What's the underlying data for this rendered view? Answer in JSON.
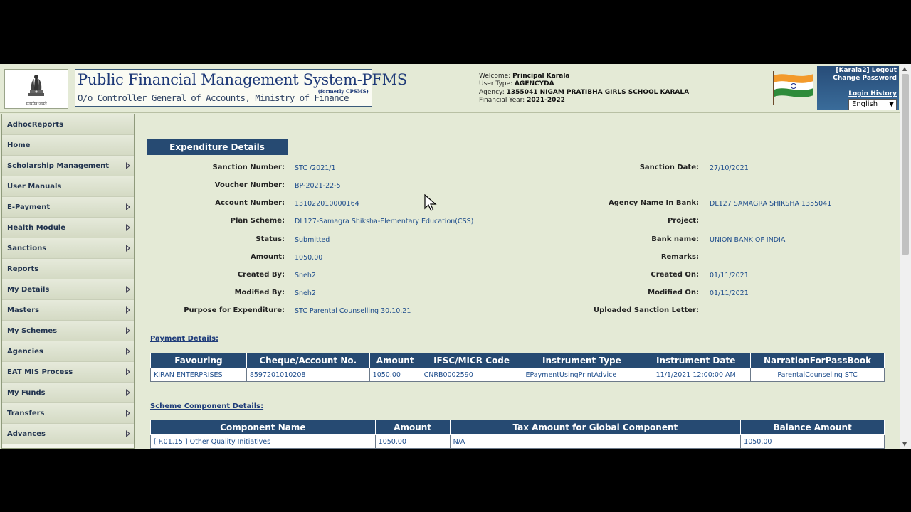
{
  "header": {
    "emblem_caption": "सत्यमेव जयते",
    "title": "Public Financial Management System-PFMS",
    "formerly": "(formerly CPSMS)",
    "subtitle": "O/o Controller General of Accounts, Ministry of Finance",
    "welcome_label": "Welcome:",
    "welcome_value": "Principal Karala",
    "user_type_label": "User Type:",
    "user_type_value": "AGENCYDA",
    "agency_label": "Agency:",
    "agency_value": "1355041 NIGAM PRATIBHA GIRLS SCHOOL KARALA",
    "fy_label": "Financial Year:",
    "fy_value": "2021-2022",
    "user_link": "[Karala2]",
    "logout": "Logout",
    "change_password": "Change Password",
    "login_history": "Login History",
    "language": "English"
  },
  "sidebar": {
    "items": [
      {
        "label": "AdhocReports",
        "has_submenu": false
      },
      {
        "label": "Home",
        "has_submenu": false
      },
      {
        "label": "Scholarship Management",
        "has_submenu": true
      },
      {
        "label": "User Manuals",
        "has_submenu": false
      },
      {
        "label": "E-Payment",
        "has_submenu": true
      },
      {
        "label": "Health Module",
        "has_submenu": true
      },
      {
        "label": "Sanctions",
        "has_submenu": true
      },
      {
        "label": "Reports",
        "has_submenu": false
      },
      {
        "label": "My Details",
        "has_submenu": true
      },
      {
        "label": "Masters",
        "has_submenu": true
      },
      {
        "label": "My Schemes",
        "has_submenu": true
      },
      {
        "label": "Agencies",
        "has_submenu": true
      },
      {
        "label": "EAT MIS Process",
        "has_submenu": true
      },
      {
        "label": "My Funds",
        "has_submenu": true
      },
      {
        "label": "Transfers",
        "has_submenu": true
      },
      {
        "label": "Advances",
        "has_submenu": true
      }
    ]
  },
  "main": {
    "heading": "Expenditure Details",
    "left_fields": [
      {
        "label": "Sanction Number:",
        "value": "STC /2021/1"
      },
      {
        "label": "Voucher Number:",
        "value": "BP-2021-22-5"
      },
      {
        "label": "Account Number:",
        "value": "131022010000164"
      },
      {
        "label": "Plan Scheme:",
        "value": "DL127-Samagra Shiksha-Elementary Education(CSS)"
      },
      {
        "label": "Status:",
        "value": "Submitted"
      },
      {
        "label": "Amount:",
        "value": "1050.00"
      },
      {
        "label": "Created By:",
        "value": "Sneh2"
      },
      {
        "label": "Modified By:",
        "value": "Sneh2"
      },
      {
        "label": "Purpose for Expenditure:",
        "value": "STC Parental Counselling 30.10.21"
      }
    ],
    "right_fields": [
      {
        "label": "Sanction Date:",
        "value": "27/10/2021"
      },
      {
        "label": "",
        "value": ""
      },
      {
        "label": "Agency Name In Bank:",
        "value": "DL127 SAMAGRA SHIKSHA 1355041"
      },
      {
        "label": "Project:",
        "value": ""
      },
      {
        "label": "Bank name:",
        "value": "UNION BANK OF INDIA"
      },
      {
        "label": "Remarks:",
        "value": ""
      },
      {
        "label": "Created On:",
        "value": "01/11/2021"
      },
      {
        "label": "Modified On:",
        "value": "01/11/2021"
      },
      {
        "label": "Uploaded Sanction Letter:",
        "value": ""
      }
    ],
    "payment_link": "Payment Details:",
    "payment_table": {
      "headers": [
        "Favouring",
        "Cheque/Account No.",
        "Amount",
        "IFSC/MICR Code",
        "Instrument Type",
        "Instrument Date",
        "NarrationForPassBook"
      ],
      "rows": [
        [
          "KIRAN ENTERPRISES",
          "8597201010208",
          "1050.00",
          "CNRB0002590",
          "EPaymentUsingPrintAdvice",
          "11/1/2021 12:00:00 AM",
          "ParentalCounseling STC"
        ]
      ]
    },
    "scheme_link": "Scheme Component Details:",
    "scheme_table": {
      "headers": [
        "Component Name",
        "Amount",
        "Tax Amount for Global Component",
        "Balance Amount"
      ],
      "rows": [
        [
          "[ F.01.15 ] Other Quality Initiatives",
          "1050.00",
          "N/A",
          "1050.00"
        ]
      ]
    }
  }
}
